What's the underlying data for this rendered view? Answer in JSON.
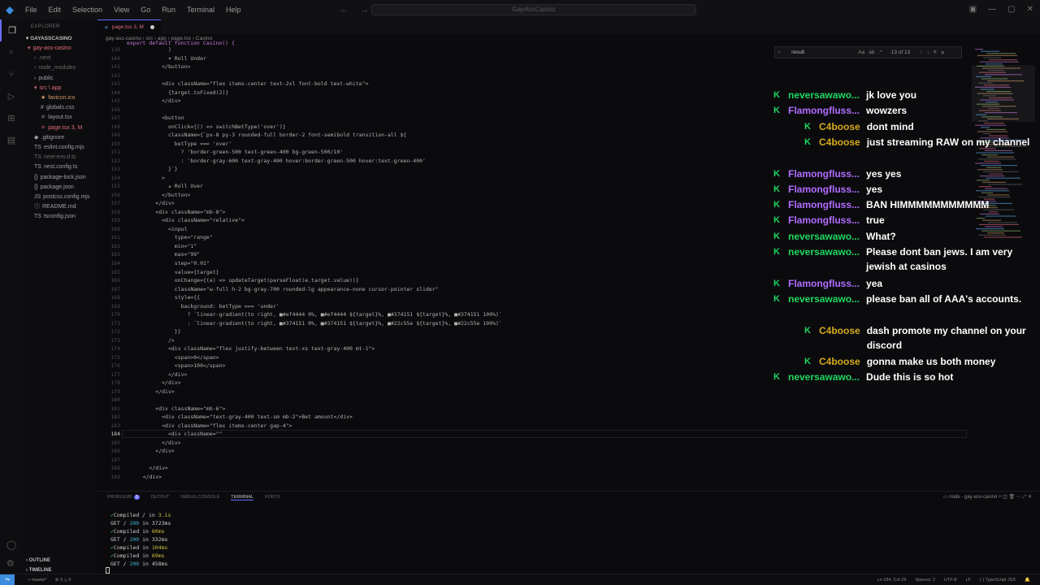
{
  "titlebar": {
    "menu": [
      "File",
      "Edit",
      "Selection",
      "View",
      "Go",
      "Run",
      "Terminal",
      "Help"
    ],
    "command_center": "GayAssCasino"
  },
  "explorer": {
    "header": "EXPLORER",
    "project": "GAYASSCASINO",
    "files": [
      {
        "label": "gay-ass-casino",
        "indent": 0,
        "color": "#e06c75",
        "icon": "▾"
      },
      {
        "label": ".next",
        "indent": 1,
        "color": "#6a6a6a",
        "icon": "›"
      },
      {
        "label": "node_modules",
        "indent": 1,
        "color": "#6a6a6a",
        "icon": "›"
      },
      {
        "label": "public",
        "indent": 1,
        "color": "#9aa0a6",
        "icon": "›"
      },
      {
        "label": "src \\ app",
        "indent": 1,
        "color": "#e06c75",
        "icon": "▾"
      },
      {
        "label": "favicon.ico",
        "indent": 2,
        "color": "#d19a66",
        "icon": "★"
      },
      {
        "label": "globals.css",
        "indent": 2,
        "color": "#9aa0a6",
        "icon": "#"
      },
      {
        "label": "layout.tsx",
        "indent": 2,
        "color": "#9aa0a6",
        "icon": "⚛"
      },
      {
        "label": "page.tsx  3, M",
        "indent": 2,
        "color": "#e06c75",
        "icon": "⚛"
      },
      {
        "label": ".gitignore",
        "indent": 1,
        "color": "#9aa0a6",
        "icon": "◆"
      },
      {
        "label": "eslint.config.mjs",
        "indent": 1,
        "color": "#9aa0a6",
        "icon": "TS"
      },
      {
        "label": "next-env.d.ts",
        "indent": 1,
        "color": "#6a6a6a",
        "icon": "TS"
      },
      {
        "label": "next.config.ts",
        "indent": 1,
        "color": "#9aa0a6",
        "icon": "TS"
      },
      {
        "label": "package-lock.json",
        "indent": 1,
        "color": "#9aa0a6",
        "icon": "{}"
      },
      {
        "label": "package.json",
        "indent": 1,
        "color": "#9aa0a6",
        "icon": "{}"
      },
      {
        "label": "postcss.config.mjs",
        "indent": 1,
        "color": "#9aa0a6",
        "icon": "JS"
      },
      {
        "label": "README.md",
        "indent": 1,
        "color": "#9aa0a6",
        "icon": "ⓘ"
      },
      {
        "label": "tsconfig.json",
        "indent": 1,
        "color": "#9aa0a6",
        "icon": "TS"
      }
    ],
    "outline": "OUTLINE",
    "timeline": "TIMELINE"
  },
  "editor": {
    "tab_label": "page.tsx  3, M",
    "breadcrumb": "gay-ass-casino › src › app › page.tsx › Casino",
    "first_line": "  export default function Casino() {",
    "lines": [
      {
        "n": "139",
        "t": "            )"
      },
      {
        "n": "140",
        "t": "            ▾ Roll Under"
      },
      {
        "n": "141",
        "t": "          </button>"
      },
      {
        "n": "142",
        "t": ""
      },
      {
        "n": "143",
        "t": "          <div className=\"flex items-center text-2xl font-bold text-white\">"
      },
      {
        "n": "144",
        "t": "            {target.toFixed(2)}"
      },
      {
        "n": "145",
        "t": "          </div>"
      },
      {
        "n": "146",
        "t": ""
      },
      {
        "n": "147",
        "t": "          <button"
      },
      {
        "n": "148",
        "t": "            onClick={() => switchBetType('over')}"
      },
      {
        "n": "149",
        "t": "            className={`px-8 py-3 rounded-full border-2 font-semibold transition-all ${"
      },
      {
        "n": "150",
        "t": "              betType === 'over'"
      },
      {
        "n": "151",
        "t": "                ? 'border-green-500 text-green-400 bg-green-500/10'"
      },
      {
        "n": "152",
        "t": "                : 'border-gray-600 text-gray-400 hover:border-green-500 hover:text-green-400'"
      },
      {
        "n": "153",
        "t": "            }`}"
      },
      {
        "n": "154",
        "t": "          >"
      },
      {
        "n": "155",
        "t": "            ▴ Roll Over"
      },
      {
        "n": "156",
        "t": "          </button>"
      },
      {
        "n": "157",
        "t": "        </div>"
      },
      {
        "n": "158",
        "t": "        <div className=\"mb-8\">"
      },
      {
        "n": "159",
        "t": "          <div className=\"relative\">"
      },
      {
        "n": "160",
        "t": "            <input"
      },
      {
        "n": "161",
        "t": "              type=\"range\""
      },
      {
        "n": "162",
        "t": "              min=\"1\""
      },
      {
        "n": "163",
        "t": "              max=\"99\""
      },
      {
        "n": "164",
        "t": "              step=\"0.01\""
      },
      {
        "n": "165",
        "t": "              value={target}"
      },
      {
        "n": "166",
        "t": "              onChange={(e) => updateTarget(parseFloat(e.target.value))}"
      },
      {
        "n": "167",
        "t": "              className=\"w-full h-2 bg-gray-700 rounded-lg appearance-none cursor-pointer slider\""
      },
      {
        "n": "168",
        "t": "              style={{"
      },
      {
        "n": "169",
        "t": "                background: betType === 'under'"
      },
      {
        "n": "170",
        "t": "                  ? `linear-gradient(to right, ■#ef4444 0%, ■#ef4444 ${target}%, ■#374151 ${target}%, ■#374151 100%)`"
      },
      {
        "n": "171",
        "t": "                  : `linear-gradient(to right, ■#374151 0%, ■#374151 ${target}%, ■#22c55e ${target}%, ■#22c55e 100%)`"
      },
      {
        "n": "172",
        "t": "              }}"
      },
      {
        "n": "173",
        "t": "            />"
      },
      {
        "n": "174",
        "t": "            <div className=\"flex justify-between text-xs text-gray-400 mt-1\">"
      },
      {
        "n": "175",
        "t": "              <span>0</span>"
      },
      {
        "n": "176",
        "t": "              <span>100</span>"
      },
      {
        "n": "177",
        "t": "            </div>"
      },
      {
        "n": "178",
        "t": "          </div>"
      },
      {
        "n": "179",
        "t": "        </div>"
      },
      {
        "n": "180",
        "t": ""
      },
      {
        "n": "181",
        "t": "        <div className=\"mb-6\">"
      },
      {
        "n": "182",
        "t": "          <div className=\"text-gray-400 text-sm mb-2\">Bet amount</div>"
      },
      {
        "n": "183",
        "t": "          <div className=\"flex items-center gap-4\">"
      },
      {
        "n": "184",
        "t": "            <div className=\"\""
      },
      {
        "n": "185",
        "t": "          </div>"
      },
      {
        "n": "186",
        "t": "        </div>"
      },
      {
        "n": "187",
        "t": ""
      },
      {
        "n": "188",
        "t": "      </div>"
      },
      {
        "n": "189",
        "t": "    </div>"
      }
    ],
    "current_line": "184"
  },
  "find_widget": {
    "query": "result",
    "count": "13 of 13"
  },
  "chat": [
    {
      "badge": "K",
      "indent": 0,
      "user": "neversawawo...",
      "user_color": "#1ed760",
      "text": "jk love you"
    },
    {
      "badge": "K",
      "indent": 0,
      "user": "Flamongfluss...",
      "user_color": "#b26cff",
      "text": "wowzers"
    },
    {
      "badge": "K",
      "indent": 1,
      "user": "C4boose",
      "user_color": "#d6a91c",
      "text": "dont mind"
    },
    {
      "badge": "K",
      "indent": 1,
      "user": "C4boose",
      "user_color": "#d6a91c",
      "text": "just streaming RAW on my channel"
    },
    {
      "badge": "K",
      "indent": 0,
      "user": "Flamongfluss...",
      "user_color": "#b26cff",
      "text": "yes yes"
    },
    {
      "badge": "K",
      "indent": 0,
      "user": "Flamongfluss...",
      "user_color": "#b26cff",
      "text": "yes"
    },
    {
      "badge": "K",
      "indent": 0,
      "user": "Flamongfluss...",
      "user_color": "#b26cff",
      "text": "BAN HIMMMMMMMMMMM"
    },
    {
      "badge": "K",
      "indent": 0,
      "user": "Flamongfluss...",
      "user_color": "#b26cff",
      "text": "true"
    },
    {
      "badge": "K",
      "indent": 0,
      "user": "neversawawo...",
      "user_color": "#1ed760",
      "text": "What?"
    },
    {
      "badge": "K",
      "indent": 0,
      "user": "neversawawo...",
      "user_color": "#1ed760",
      "text": "Please dont ban jews. I am very jewish at casinos"
    },
    {
      "badge": "K",
      "indent": 0,
      "user": "Flamongfluss...",
      "user_color": "#b26cff",
      "text": "yea"
    },
    {
      "badge": "K",
      "indent": 0,
      "user": "neversawawo...",
      "user_color": "#1ed760",
      "text": "please ban all of AAA's accounts."
    },
    {
      "badge": "K",
      "indent": 1,
      "user": "C4boose",
      "user_color": "#d6a91c",
      "text": "dash promote my channel on your discord"
    },
    {
      "badge": "K",
      "indent": 1,
      "user": "C4boose",
      "user_color": "#d6a91c",
      "text": "gonna make us both money"
    },
    {
      "badge": "K",
      "indent": 0,
      "user": "neversawawo...",
      "user_color": "#1ed760",
      "text": "Dude this is so hot"
    }
  ],
  "panel": {
    "tabs": [
      "PROBLEMS",
      "OUTPUT",
      "DEBUG CONSOLE",
      "TERMINAL",
      "PORTS"
    ],
    "problems_count": "3",
    "active_tab": "TERMINAL",
    "terminal_name": "node - gay-ass-casino",
    "terminal": [
      {
        "ok": "✓",
        "t1": "Compiled / in ",
        "t2": "3.1s",
        "t3": ""
      },
      {
        "ok": "",
        "t1": "GET / ",
        "t2": "200",
        "t3": " in 3723ms"
      },
      {
        "ok": "✓",
        "t1": "Compiled in ",
        "t2": "60ms",
        "t3": ""
      },
      {
        "ok": "",
        "t1": "GET / ",
        "t2": "200",
        "t3": " in 332ms"
      },
      {
        "ok": "✓",
        "t1": "Compiled in ",
        "t2": "104ms",
        "t3": ""
      },
      {
        "ok": "✓",
        "t1": "Compiled in ",
        "t2": "69ms",
        "t3": ""
      },
      {
        "ok": "",
        "t1": "GET / ",
        "t2": "200",
        "t3": " in 458ms"
      }
    ]
  },
  "statusbar": {
    "branch": "master*",
    "problems": "⊗ 3 △ 0",
    "right": [
      "Ln 184, Col 29",
      "Spaces: 2",
      "UTF-8",
      "LF",
      "{ } TypeScript JSX"
    ]
  },
  "colors": {
    "accent": "#6c6cff",
    "kick_green": "#1ed760",
    "user_green": "#1ed760",
    "user_purple": "#b26cff",
    "user_gold": "#d6a91c"
  }
}
